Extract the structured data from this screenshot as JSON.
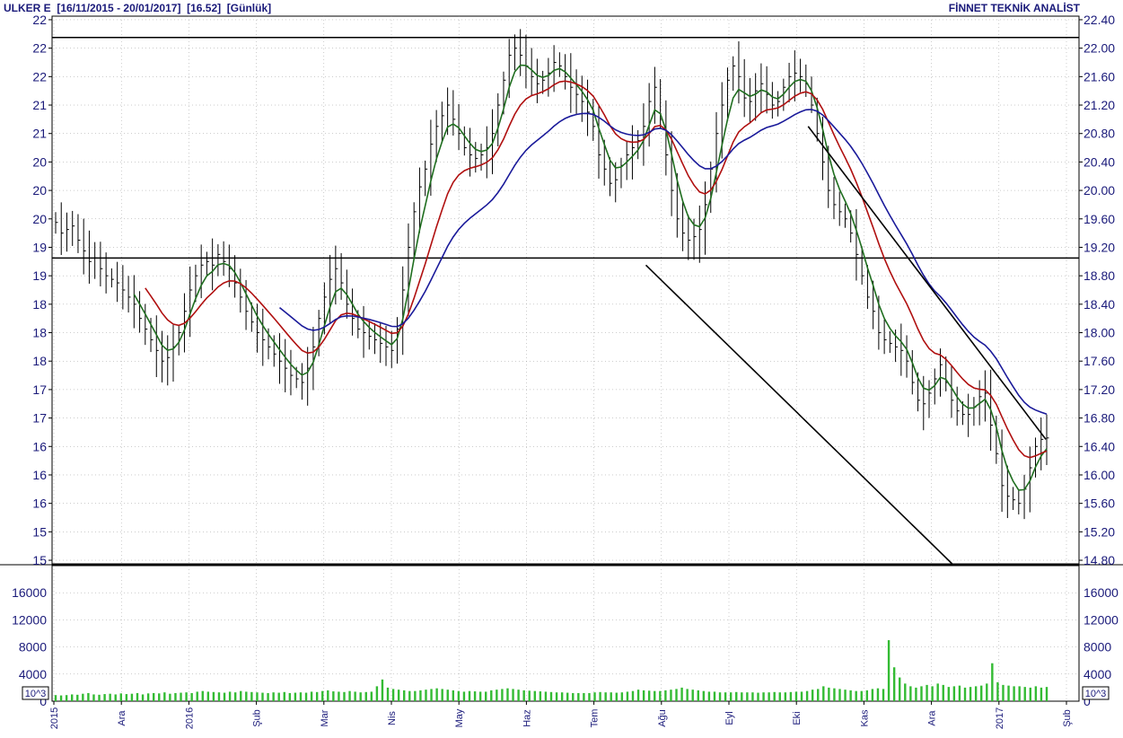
{
  "header": {
    "left": "ULKER E  [16/11/2015 - 20/01/2017]  [16.52]  [Günlük]",
    "right": "FİNNET TEKNİK ANALİST"
  },
  "colors": {
    "background": "#ffffff",
    "text": "#1a1a7a",
    "price_bars": "#000000",
    "ma_green": "#1f6e1f",
    "ma_red": "#b01010",
    "ma_blue": "#1a1a9a",
    "volume": "#33bb33",
    "grid": "#9a9a9a"
  },
  "chart_data": [
    {
      "type": "line",
      "title": "",
      "ylim": [
        14.75,
        22.45
      ],
      "grid": true,
      "legend": "none",
      "right_axis_ticks": [
        "22.40",
        "22.00",
        "21.60",
        "21.20",
        "20.80",
        "20.40",
        "20.00",
        "19.60",
        "19.20",
        "18.80",
        "18.40",
        "18.00",
        "17.60",
        "17.20",
        "16.80",
        "16.40",
        "16.00",
        "15.60",
        "15.20",
        "14.80"
      ],
      "left_axis_ticks": [
        "22",
        "22",
        "22",
        "21",
        "21",
        "20",
        "20",
        "20",
        "19",
        "19",
        "18",
        "18",
        "18",
        "17",
        "17",
        "16",
        "16",
        "16",
        "15",
        "15"
      ],
      "x_tick_labels": [
        "2015",
        "Ara",
        "2016",
        "Şub",
        "Mar",
        "Nis",
        "May",
        "Haz",
        "Tem",
        "Ağu",
        "Eyl",
        "Eki",
        "Kas",
        "Ara",
        "2017",
        "Şub"
      ],
      "horizontal_levels": [
        22.15,
        19.05
      ],
      "trendlines": [
        {
          "name": "channel-support",
          "from": {
            "date": "2016-08-01",
            "value": 18.95
          },
          "to": {
            "date": "2016-12-13",
            "value": 14.75
          }
        },
        {
          "name": "channel-resistance",
          "from": {
            "date": "2016-10-11",
            "value": 20.9
          },
          "to": {
            "date": "2017-01-23",
            "value": 16.5
          }
        }
      ],
      "series": [
        {
          "name": "price",
          "kind": "ohlc",
          "color": "#000000",
          "closes": [
            19.55,
            19.4,
            19.45,
            19.5,
            19.3,
            19.15,
            19.0,
            19.05,
            18.9,
            18.8,
            18.75,
            18.7,
            18.6,
            18.5,
            18.4,
            18.2,
            18.05,
            17.9,
            17.75,
            17.6,
            17.65,
            17.8,
            18.0,
            18.3,
            18.6,
            18.8,
            18.95,
            19.0,
            18.95,
            19.1,
            19.0,
            18.9,
            18.7,
            18.5,
            18.3,
            18.15,
            18.0,
            17.9,
            17.8,
            17.7,
            17.6,
            17.5,
            17.4,
            17.35,
            17.3,
            17.5,
            17.8,
            18.2,
            18.5,
            18.75,
            18.9,
            18.7,
            18.4,
            18.2,
            18.05,
            18.0,
            17.95,
            17.9,
            17.85,
            17.8,
            17.75,
            18.05,
            18.6,
            19.2,
            19.7,
            20.05,
            20.3,
            20.65,
            20.9,
            21.05,
            21.2,
            21.0,
            20.8,
            20.6,
            20.5,
            20.45,
            20.5,
            20.6,
            20.8,
            21.2,
            21.55,
            21.9,
            22.0,
            21.9,
            21.75,
            21.6,
            21.5,
            21.55,
            21.65,
            21.8,
            21.75,
            21.6,
            21.45,
            21.35,
            21.25,
            21.1,
            20.9,
            20.5,
            20.3,
            20.1,
            20.15,
            20.35,
            20.5,
            20.6,
            20.7,
            20.9,
            21.25,
            21.45,
            21.0,
            20.5,
            20.0,
            19.6,
            19.4,
            19.3,
            19.35,
            19.45,
            19.8,
            20.3,
            20.8,
            21.2,
            21.55,
            21.75,
            21.6,
            21.3,
            21.25,
            21.4,
            21.5,
            21.35,
            21.2,
            21.25,
            21.45,
            21.6,
            21.65,
            21.6,
            21.5,
            21.2,
            20.8,
            20.4,
            20.0,
            19.8,
            19.7,
            19.6,
            19.4,
            19.1,
            18.8,
            18.5,
            18.3,
            18.0,
            17.9,
            17.85,
            17.8,
            17.75,
            17.6,
            17.3,
            17.05,
            17.0,
            17.15,
            17.35,
            17.55,
            17.3,
            17.05,
            16.9,
            16.85,
            16.85,
            16.95,
            17.1,
            17.15,
            16.7,
            16.3,
            15.85,
            15.7,
            15.65,
            15.6,
            15.8,
            16.1,
            16.4,
            16.5,
            16.52
          ]
        },
        {
          "name": "ma-short",
          "color": "#1f6e1f"
        },
        {
          "name": "ma-medium",
          "color": "#b01010"
        },
        {
          "name": "ma-long",
          "color": "#1a1a9a"
        }
      ]
    },
    {
      "type": "bar",
      "title": "",
      "unit_label": "10^3",
      "ylim": [
        0,
        20000
      ],
      "grid": true,
      "axis_ticks": [
        "16000",
        "12000",
        "8000",
        "4000",
        "0"
      ],
      "values": [
        900,
        850,
        900,
        1000,
        950,
        1100,
        1200,
        1000,
        950,
        1050,
        1100,
        1000,
        1150,
        1050,
        1100,
        1200,
        1000,
        1150,
        1200,
        1150,
        1300,
        1100,
        1200,
        1250,
        1300,
        1200,
        1400,
        1500,
        1400,
        1350,
        1300,
        1250,
        1400,
        1300,
        1500,
        1400,
        1350,
        1300,
        1250,
        1200,
        1300,
        1250,
        1350,
        1200,
        1250,
        1300,
        1250,
        1400,
        1350,
        1500,
        1600,
        1450,
        1400,
        1350,
        1500,
        1400,
        1300,
        1350,
        1400,
        2200,
        3200,
        2000,
        1800,
        1700,
        1600,
        1500,
        1500,
        1600,
        1700,
        1800,
        1900,
        1800,
        1700,
        1600,
        1500,
        1400,
        1500,
        1450,
        1400,
        1400,
        1600,
        1700,
        1800,
        1900,
        1800,
        1700,
        1600,
        1550,
        1500,
        1450,
        1400,
        1350,
        1300,
        1300,
        1250,
        1200,
        1200,
        1200,
        1200,
        1300,
        1350,
        1300,
        1300,
        1250,
        1300,
        1400,
        1500,
        1700,
        1600,
        1550,
        1500,
        1500,
        1600,
        1700,
        1800,
        2000,
        1800,
        1700,
        1600,
        1500,
        1400,
        1400,
        1300,
        1300,
        1300,
        1350,
        1300,
        1300,
        1300,
        1250,
        1300,
        1300,
        1350,
        1300,
        1300,
        1350,
        1400,
        1400,
        1500,
        1700,
        1800,
        2200,
        2000,
        1900,
        1800,
        1700,
        1600,
        1500,
        1500,
        1600,
        1800,
        1900,
        1800,
        9000,
        5000,
        3500,
        2600,
        2200,
        2000,
        2200,
        2400,
        2200,
        2600,
        2400,
        2100,
        2200,
        2300,
        2000,
        2100,
        2200,
        2300,
        2600,
        5600,
        2800,
        2400,
        2300,
        2200,
        2200,
        2100,
        2000,
        2200,
        2000,
        2100
      ]
    }
  ]
}
